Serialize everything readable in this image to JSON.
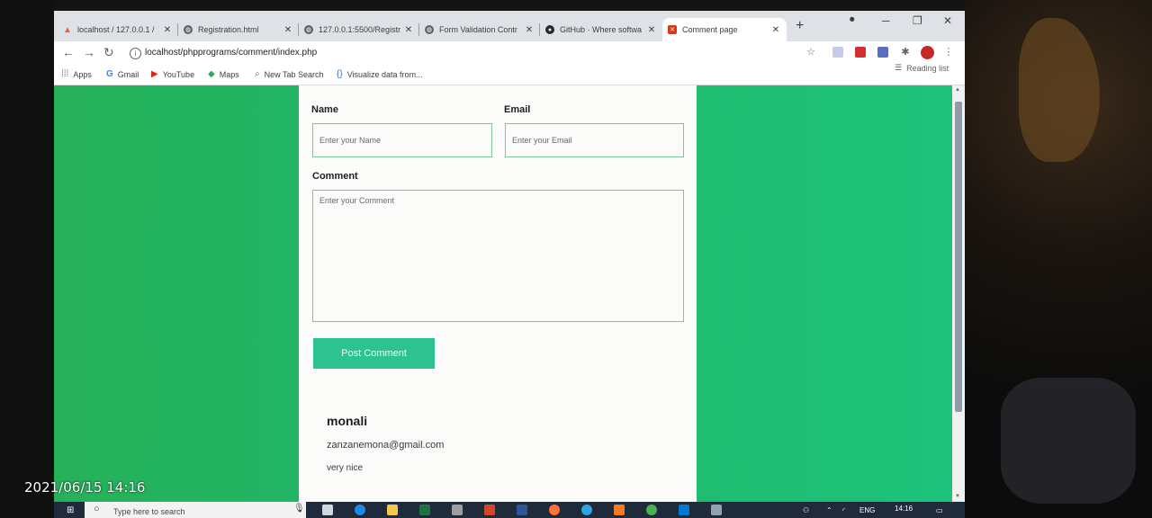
{
  "tabs": [
    {
      "title": "localhost / 127.0.0.1 /",
      "favicon": "phpmyadmin-icon"
    },
    {
      "title": "Registration.html",
      "favicon": "globe-icon"
    },
    {
      "title": "127.0.0.1:5500/Registr",
      "favicon": "globe-icon"
    },
    {
      "title": "Form Validation Contr",
      "favicon": "globe-icon"
    },
    {
      "title": "GitHub · Where softwa",
      "favicon": "github-icon"
    },
    {
      "title": "Comment page",
      "favicon": "xampp-icon",
      "active": true
    }
  ],
  "tab_close": "✕",
  "toolbar": {
    "url": "localhost/phpprograms/comment/index.php"
  },
  "bookmarks": [
    {
      "label": "Apps",
      "icon": "apps-grid-icon"
    },
    {
      "label": "Gmail",
      "icon": "google-icon"
    },
    {
      "label": "YouTube",
      "icon": "youtube-icon"
    },
    {
      "label": "Maps",
      "icon": "maps-icon"
    },
    {
      "label": "New Tab Search",
      "icon": "search-icon"
    },
    {
      "label": "Visualize data from...",
      "icon": "braces-icon"
    }
  ],
  "reading_list": "Reading list",
  "form": {
    "name_label": "Name",
    "name_placeholder": "Enter your Name",
    "email_label": "Email",
    "email_placeholder": "Enter your Email",
    "comment_label": "Comment",
    "comment_placeholder": "Enter your Comment",
    "submit_label": "Post Comment"
  },
  "comment": {
    "name": "monali",
    "email": "zanzanemona@gmail.com",
    "text": "very nice"
  },
  "taskbar": {
    "search_placeholder": "Type here to search",
    "language": "ENG",
    "time": "14:16"
  },
  "photo_timestamp": "2021/06/15 14:16",
  "colors": {
    "page_background": "#1fb86a",
    "button": "#2ec290",
    "field_border": "#7bc79b"
  }
}
